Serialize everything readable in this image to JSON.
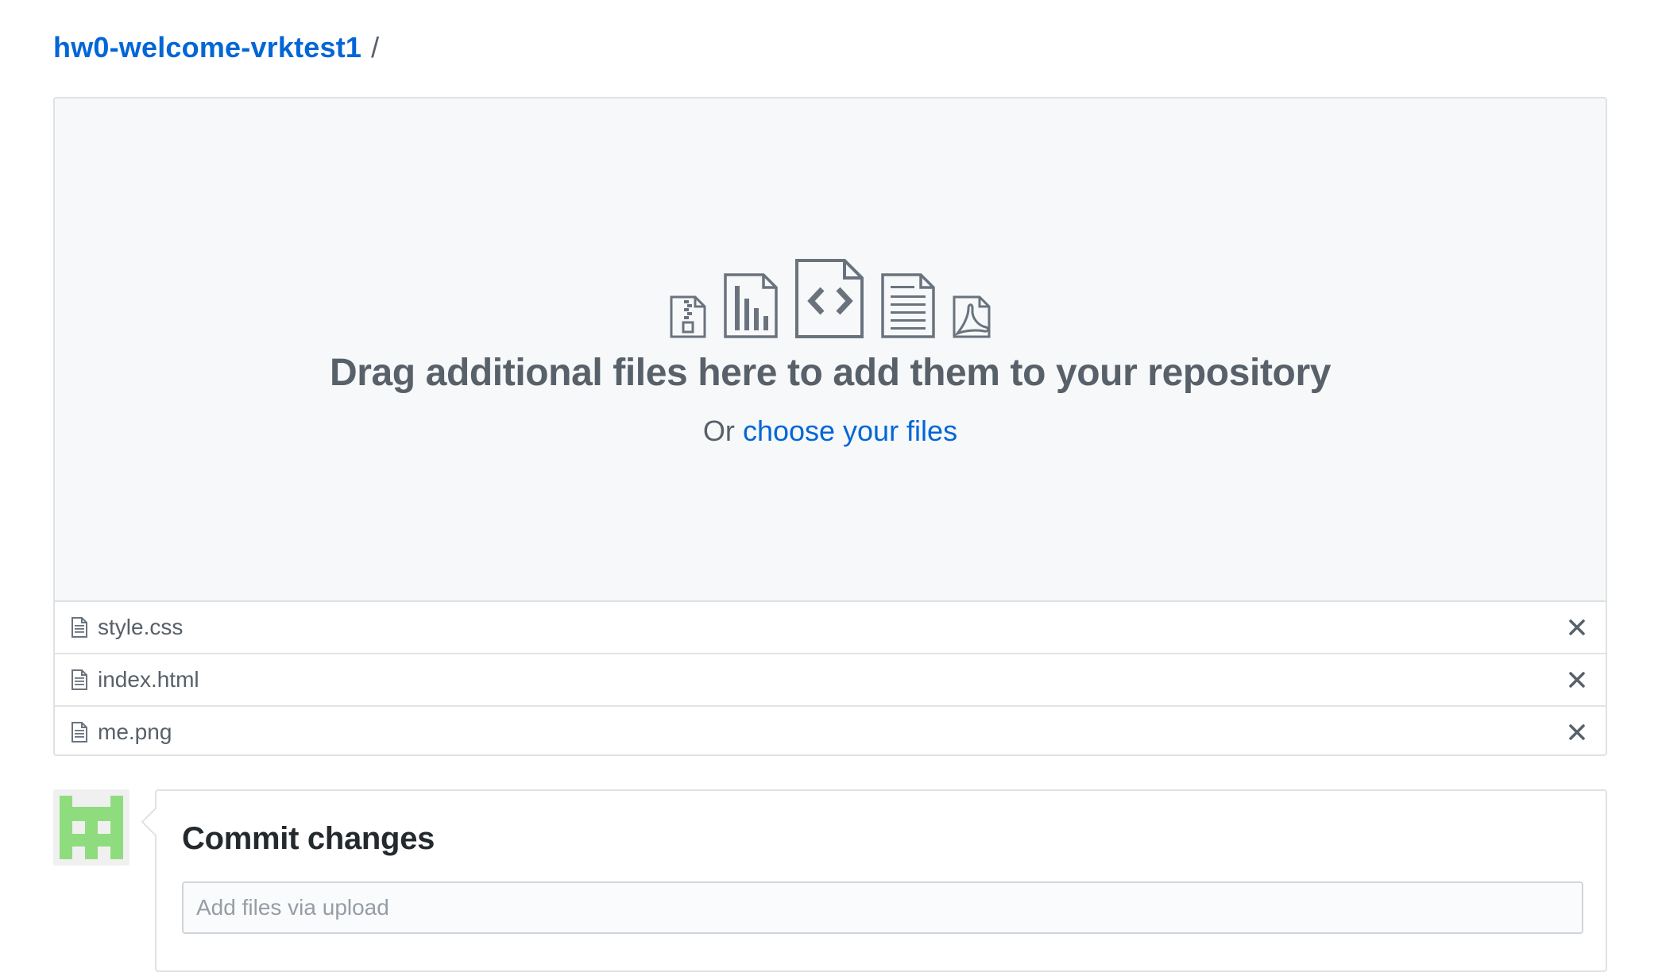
{
  "breadcrumb": {
    "repo_name": "hw0-welcome-vrktest1",
    "separator": "/"
  },
  "dropzone": {
    "title": "Drag additional files here to add them to your repository",
    "subtitle_prefix": "Or",
    "choose_link": "choose your files",
    "icons": [
      "file-zip-icon",
      "file-chart-icon",
      "file-code-icon",
      "file-text-icon",
      "file-pdf-icon"
    ]
  },
  "files": [
    {
      "name": "style.css"
    },
    {
      "name": "index.html"
    },
    {
      "name": "me.png"
    }
  ],
  "commit": {
    "title": "Commit changes",
    "summary_placeholder": "Add files via upload",
    "summary_value": ""
  },
  "colors": {
    "link": "#0366d6",
    "avatar": "#8fdc7f",
    "dropzone_bg": "#f6f8fa"
  }
}
